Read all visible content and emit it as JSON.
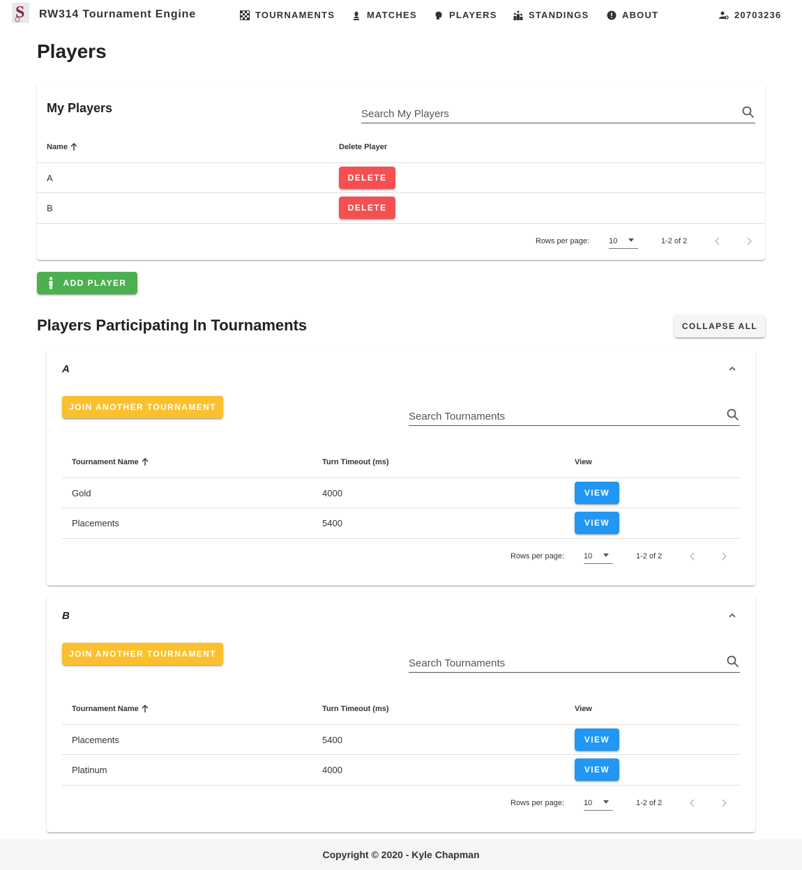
{
  "app": {
    "title": "RW314 Tournament Engine",
    "user_id": "20703236"
  },
  "nav": {
    "tournaments": "TOURNAMENTS",
    "matches": "MATCHES",
    "players": "PLAYERS",
    "standings": "STANDINGS",
    "about": "ABOUT"
  },
  "page": {
    "title": "Players"
  },
  "my_players": {
    "title": "My Players",
    "search_placeholder": "Search My Players",
    "columns": {
      "name": "Name",
      "delete": "Delete Player"
    },
    "rows": [
      {
        "name": "A",
        "action": "DELETE"
      },
      {
        "name": "B",
        "action": "DELETE"
      }
    ],
    "pagination": {
      "rows_per_page_label": "Rows per page:",
      "rows_per_page": "10",
      "range": "1-2 of 2"
    }
  },
  "add_player_label": "ADD PLAYER",
  "participating": {
    "title": "Players Participating In Tournaments",
    "collapse_all_label": "COLLAPSE ALL",
    "panels": [
      {
        "player": "A",
        "join_label": "JOIN ANOTHER TOURNAMENT",
        "search_placeholder": "Search Tournaments",
        "columns": {
          "name": "Tournament Name",
          "timeout": "Turn Timeout (ms)",
          "view": "View"
        },
        "rows": [
          {
            "name": "Gold",
            "timeout": "4000",
            "action": "VIEW"
          },
          {
            "name": "Placements",
            "timeout": "5400",
            "action": "VIEW"
          }
        ],
        "pagination": {
          "rows_per_page_label": "Rows per page:",
          "rows_per_page": "10",
          "range": "1-2 of 2"
        }
      },
      {
        "player": "B",
        "join_label": "JOIN ANOTHER TOURNAMENT",
        "search_placeholder": "Search Tournaments",
        "columns": {
          "name": "Tournament Name",
          "timeout": "Turn Timeout (ms)",
          "view": "View"
        },
        "rows": [
          {
            "name": "Placements",
            "timeout": "5400",
            "action": "VIEW"
          },
          {
            "name": "Platinum",
            "timeout": "4000",
            "action": "VIEW"
          }
        ],
        "pagination": {
          "rows_per_page_label": "Rows per page:",
          "rows_per_page": "10",
          "range": "1-2 of 2"
        }
      }
    ]
  },
  "footer": {
    "text": "Copyright © 2020 - Kyle Chapman"
  },
  "colors": {
    "delete": "#f44f52",
    "view": "#2196f3",
    "add": "#4caf50",
    "join": "#fbc02d",
    "footer_bg": "#f5f5f5"
  }
}
